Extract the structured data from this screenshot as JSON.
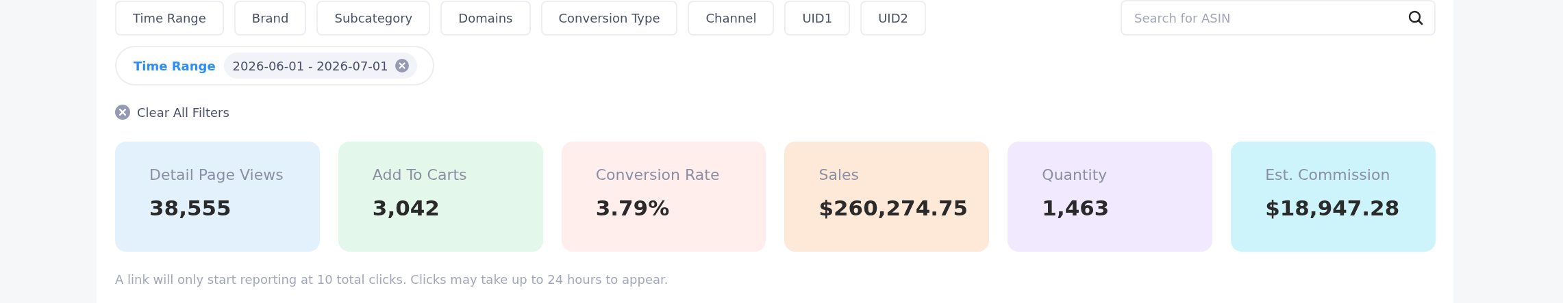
{
  "filters": [
    "Time Range",
    "Brand",
    "Subcategory",
    "Domains",
    "Conversion Type",
    "Channel",
    "UID1",
    "UID2"
  ],
  "search": {
    "placeholder": "Search for ASIN"
  },
  "active_filters": [
    {
      "label": "Time Range",
      "value": "2026-06-01 - 2026-07-01"
    }
  ],
  "clear_all": "Clear All Filters",
  "metrics": [
    {
      "label": "Detail Page Views",
      "value": "38,555",
      "color": "#e3f1fd"
    },
    {
      "label": "Add To Carts",
      "value": "3,042",
      "color": "#e3f8ea"
    },
    {
      "label": "Conversion Rate",
      "value": "3.79%",
      "color": "#ffeeec"
    },
    {
      "label": "Sales",
      "value": "$260,274.75",
      "color": "#fee8d8"
    },
    {
      "label": "Quantity",
      "value": "1,463",
      "color": "#f1e9fd"
    },
    {
      "label": "Est. Commission",
      "value": "$18,947.28",
      "color": "#ccf4fa"
    }
  ],
  "note": "A link will only start reporting at 10 total clicks. Clicks may take up to 24 hours to appear."
}
